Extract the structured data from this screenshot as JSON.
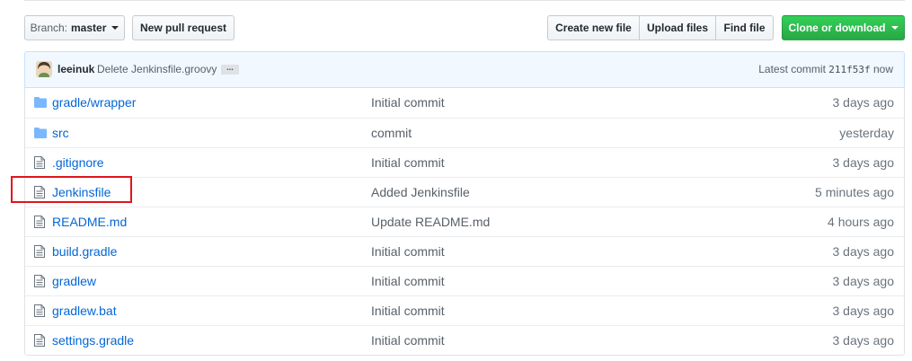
{
  "toolbar": {
    "branch_prefix": "Branch:",
    "branch_name": "master",
    "new_pull_request": "New pull request",
    "create_new_file": "Create new file",
    "upload_files": "Upload files",
    "find_file": "Find file",
    "clone_or_download": "Clone or download"
  },
  "commit": {
    "author": "leeinuk",
    "message": "Delete Jenkinsfile.groovy",
    "ellipsis": "...",
    "latest_prefix": "Latest commit",
    "sha": "211f53f",
    "time": "now"
  },
  "files": [
    {
      "name": "gradle/wrapper",
      "type": "dir",
      "message": "Initial commit",
      "age": "3 days ago"
    },
    {
      "name": "src",
      "type": "dir",
      "message": "commit",
      "age": "yesterday"
    },
    {
      "name": ".gitignore",
      "type": "file",
      "message": "Initial commit",
      "age": "3 days ago"
    },
    {
      "name": "Jenkinsfile",
      "type": "file",
      "message": "Added Jenkinsfile",
      "age": "5 minutes ago"
    },
    {
      "name": "README.md",
      "type": "file",
      "message": "Update README.md",
      "age": "4 hours ago"
    },
    {
      "name": "build.gradle",
      "type": "file",
      "message": "Initial commit",
      "age": "3 days ago"
    },
    {
      "name": "gradlew",
      "type": "file",
      "message": "Initial commit",
      "age": "3 days ago"
    },
    {
      "name": "gradlew.bat",
      "type": "file",
      "message": "Initial commit",
      "age": "3 days ago"
    },
    {
      "name": "settings.gradle",
      "type": "file",
      "message": "Initial commit",
      "age": "3 days ago"
    }
  ],
  "colors": {
    "link": "#0366d6",
    "green_button": "#28a745",
    "highlight_box": "#e2141b",
    "folder_icon": "#79b8ff"
  }
}
